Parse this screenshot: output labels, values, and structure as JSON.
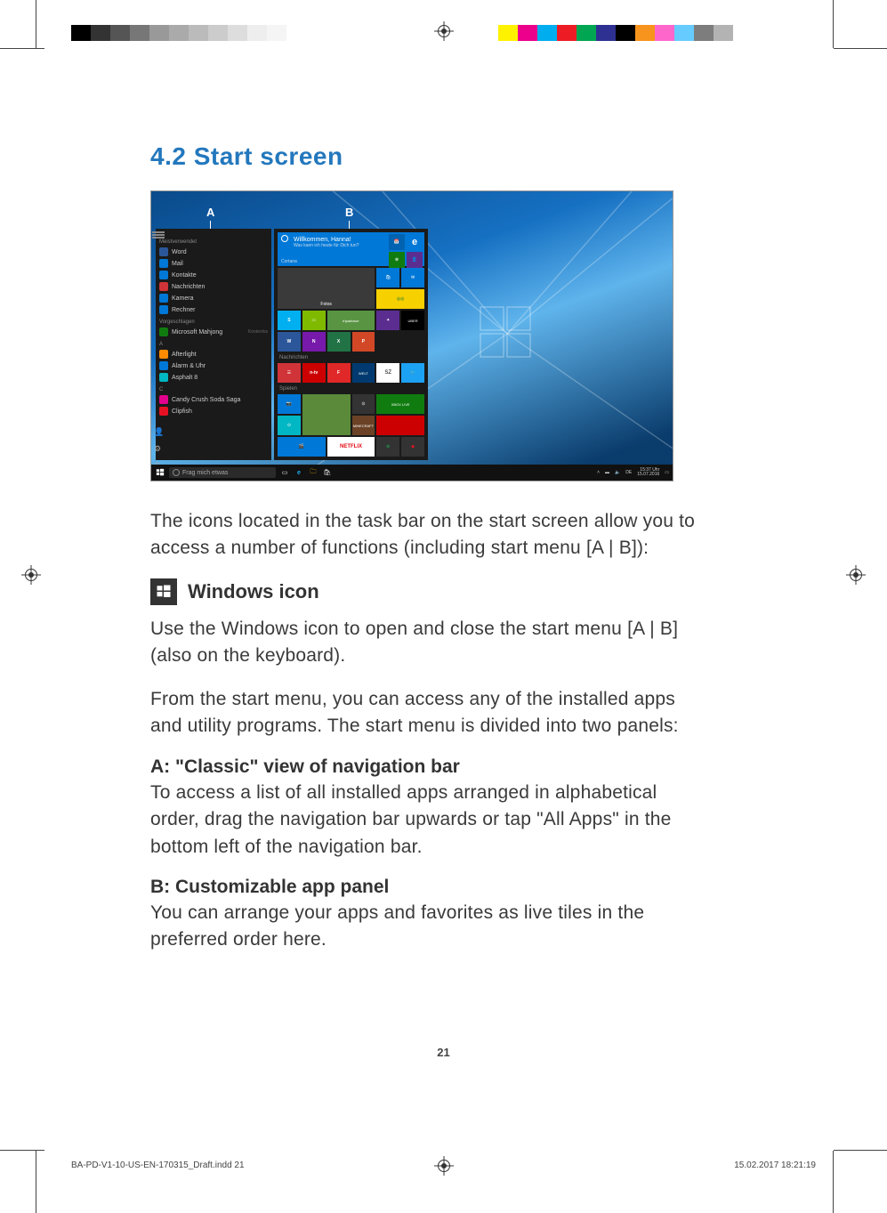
{
  "doc": {
    "section_title": "4.2 Start screen",
    "intro": "The icons located in the task bar on the start screen allow you to access a number of functions (including start menu [A | B]):",
    "win_heading": "Windows icon",
    "win_p1": "Use the Windows icon to open and close the start menu [A | B] (also on the keyboard).",
    "win_p2": "From the start menu, you can access any of the installed apps and utility programs. The start menu is divided into two panels:",
    "a_head": "A: \"Classic\" view of navigation bar",
    "a_body": "To access a list of all installed apps arranged in alphabetical order, drag the navigation bar upwards or tap \"All Apps\" in the bottom left of the navigation bar.",
    "b_head": "B: Customizable app panel",
    "b_body": "You can arrange your apps and favorites as live tiles in the preferred order here.",
    "page_number": "21",
    "footer_file": "BA-PD-V1-10-US-EN-170315_Draft.indd   21",
    "footer_date": "15.02.2017   18:21:19"
  },
  "screenshot": {
    "label_a": "A",
    "label_b": "B",
    "taskbar_search": "Frag mich etwas",
    "taskbar_time": "15:37 Uhr",
    "taskbar_date": "15.07.2016",
    "apps": {
      "cat_recent": "Meistverwendet",
      "recent_items": [
        {
          "label": "Word",
          "color": "#2b579a"
        },
        {
          "label": "Mail",
          "color": "#0078d7"
        },
        {
          "label": "Kontakte",
          "color": "#0078d7"
        },
        {
          "label": "Nachrichten",
          "color": "#d13438"
        },
        {
          "label": "Kamera",
          "color": "#0078d7"
        },
        {
          "label": "Rechner",
          "color": "#0078d7"
        }
      ],
      "cat_suggest": "Vorgeschlagen",
      "suggest_item": {
        "label": "Microsoft Mahjong",
        "badge": "Kostenlos",
        "color": "#107c10"
      },
      "cat_a": "A",
      "a_items": [
        {
          "label": "Afterlight",
          "color": "#ff8c00"
        },
        {
          "label": "Alarm & Uhr",
          "color": "#0078d7"
        },
        {
          "label": "Asphalt 8",
          "color": "#00b7c3"
        }
      ],
      "cat_c": "C",
      "c_items": [
        {
          "label": "Candy Crush Soda Saga",
          "color": "#e3008c"
        },
        {
          "label": "Clipfish",
          "color": "#e81123"
        }
      ]
    },
    "tiles": {
      "cortana_greeting": "Willkommen, Hanna!",
      "cortana_sub": "Was kann ich heute für Dich tun?",
      "cortana_label": "Cortana",
      "cat_news": "Nachrichten",
      "cat_play": "Spielen",
      "items": {
        "calendar": "Kalender",
        "edge": "e",
        "xbox": "XBOX",
        "store": "Store",
        "fotos": "Fotos",
        "skype": "S",
        "tripadvisor": "tripadvisor",
        "uber": "UBER",
        "word": "W",
        "onenote": "N",
        "excel": "X",
        "powerpoint": "P",
        "news": "☰",
        "ntv": "n-tv",
        "flipboard": "F",
        "welt": "WELT",
        "sz": "SZ",
        "twitter": "🐦",
        "camera": "📷",
        "xboxlive": "XBOX LIVE",
        "groove": "⊙",
        "minecraft": "MINECRAFT",
        "movies": "🎬",
        "netflix": "NETFLIX",
        "target": "⊚"
      }
    }
  },
  "colorbars": {
    "left": [
      "#000000",
      "#333333",
      "#555555",
      "#777777",
      "#999999",
      "#aaaaaa",
      "#bbbbbb",
      "#cccccc",
      "#dddddd",
      "#eeeeee",
      "#f5f5f5",
      "#ffffff"
    ],
    "right": [
      "#fff200",
      "#ec008c",
      "#00aeef",
      "#ed1c24",
      "#00a651",
      "#2e3192",
      "#000000",
      "#f7941d",
      "#ff66cc",
      "#66ccff",
      "#7d7d7d",
      "#b3b3b3"
    ]
  }
}
